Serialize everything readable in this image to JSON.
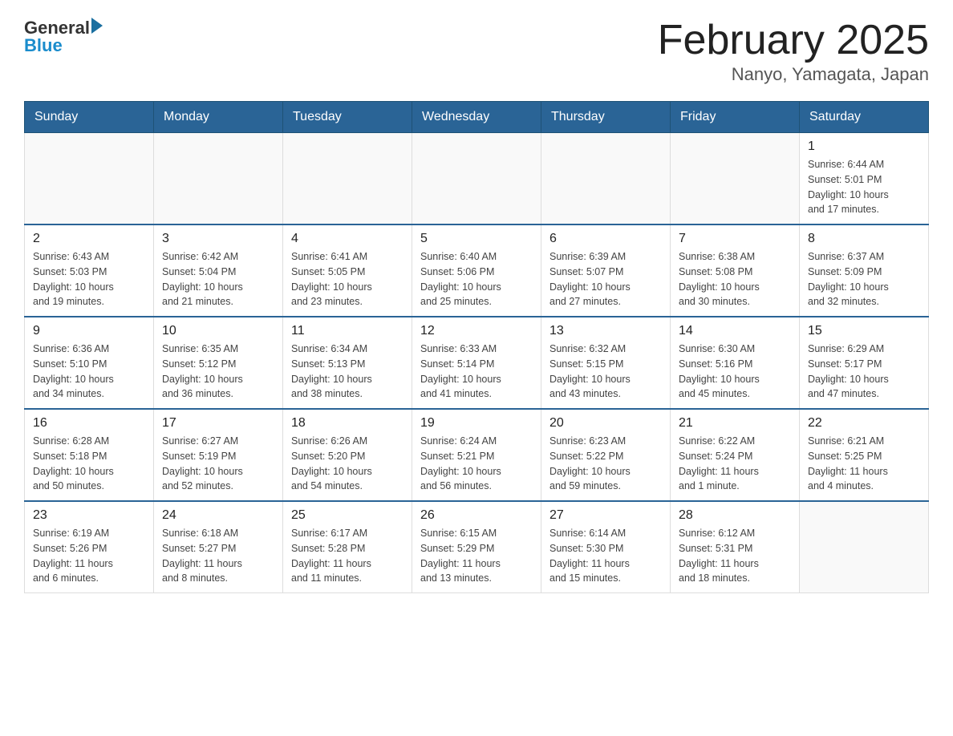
{
  "header": {
    "logo_general": "General",
    "logo_blue": "Blue",
    "title": "February 2025",
    "subtitle": "Nanyo, Yamagata, Japan"
  },
  "days_of_week": [
    "Sunday",
    "Monday",
    "Tuesday",
    "Wednesday",
    "Thursday",
    "Friday",
    "Saturday"
  ],
  "weeks": [
    {
      "days": [
        {
          "num": "",
          "info": ""
        },
        {
          "num": "",
          "info": ""
        },
        {
          "num": "",
          "info": ""
        },
        {
          "num": "",
          "info": ""
        },
        {
          "num": "",
          "info": ""
        },
        {
          "num": "",
          "info": ""
        },
        {
          "num": "1",
          "info": "Sunrise: 6:44 AM\nSunset: 5:01 PM\nDaylight: 10 hours\nand 17 minutes."
        }
      ]
    },
    {
      "days": [
        {
          "num": "2",
          "info": "Sunrise: 6:43 AM\nSunset: 5:03 PM\nDaylight: 10 hours\nand 19 minutes."
        },
        {
          "num": "3",
          "info": "Sunrise: 6:42 AM\nSunset: 5:04 PM\nDaylight: 10 hours\nand 21 minutes."
        },
        {
          "num": "4",
          "info": "Sunrise: 6:41 AM\nSunset: 5:05 PM\nDaylight: 10 hours\nand 23 minutes."
        },
        {
          "num": "5",
          "info": "Sunrise: 6:40 AM\nSunset: 5:06 PM\nDaylight: 10 hours\nand 25 minutes."
        },
        {
          "num": "6",
          "info": "Sunrise: 6:39 AM\nSunset: 5:07 PM\nDaylight: 10 hours\nand 27 minutes."
        },
        {
          "num": "7",
          "info": "Sunrise: 6:38 AM\nSunset: 5:08 PM\nDaylight: 10 hours\nand 30 minutes."
        },
        {
          "num": "8",
          "info": "Sunrise: 6:37 AM\nSunset: 5:09 PM\nDaylight: 10 hours\nand 32 minutes."
        }
      ]
    },
    {
      "days": [
        {
          "num": "9",
          "info": "Sunrise: 6:36 AM\nSunset: 5:10 PM\nDaylight: 10 hours\nand 34 minutes."
        },
        {
          "num": "10",
          "info": "Sunrise: 6:35 AM\nSunset: 5:12 PM\nDaylight: 10 hours\nand 36 minutes."
        },
        {
          "num": "11",
          "info": "Sunrise: 6:34 AM\nSunset: 5:13 PM\nDaylight: 10 hours\nand 38 minutes."
        },
        {
          "num": "12",
          "info": "Sunrise: 6:33 AM\nSunset: 5:14 PM\nDaylight: 10 hours\nand 41 minutes."
        },
        {
          "num": "13",
          "info": "Sunrise: 6:32 AM\nSunset: 5:15 PM\nDaylight: 10 hours\nand 43 minutes."
        },
        {
          "num": "14",
          "info": "Sunrise: 6:30 AM\nSunset: 5:16 PM\nDaylight: 10 hours\nand 45 minutes."
        },
        {
          "num": "15",
          "info": "Sunrise: 6:29 AM\nSunset: 5:17 PM\nDaylight: 10 hours\nand 47 minutes."
        }
      ]
    },
    {
      "days": [
        {
          "num": "16",
          "info": "Sunrise: 6:28 AM\nSunset: 5:18 PM\nDaylight: 10 hours\nand 50 minutes."
        },
        {
          "num": "17",
          "info": "Sunrise: 6:27 AM\nSunset: 5:19 PM\nDaylight: 10 hours\nand 52 minutes."
        },
        {
          "num": "18",
          "info": "Sunrise: 6:26 AM\nSunset: 5:20 PM\nDaylight: 10 hours\nand 54 minutes."
        },
        {
          "num": "19",
          "info": "Sunrise: 6:24 AM\nSunset: 5:21 PM\nDaylight: 10 hours\nand 56 minutes."
        },
        {
          "num": "20",
          "info": "Sunrise: 6:23 AM\nSunset: 5:22 PM\nDaylight: 10 hours\nand 59 minutes."
        },
        {
          "num": "21",
          "info": "Sunrise: 6:22 AM\nSunset: 5:24 PM\nDaylight: 11 hours\nand 1 minute."
        },
        {
          "num": "22",
          "info": "Sunrise: 6:21 AM\nSunset: 5:25 PM\nDaylight: 11 hours\nand 4 minutes."
        }
      ]
    },
    {
      "days": [
        {
          "num": "23",
          "info": "Sunrise: 6:19 AM\nSunset: 5:26 PM\nDaylight: 11 hours\nand 6 minutes."
        },
        {
          "num": "24",
          "info": "Sunrise: 6:18 AM\nSunset: 5:27 PM\nDaylight: 11 hours\nand 8 minutes."
        },
        {
          "num": "25",
          "info": "Sunrise: 6:17 AM\nSunset: 5:28 PM\nDaylight: 11 hours\nand 11 minutes."
        },
        {
          "num": "26",
          "info": "Sunrise: 6:15 AM\nSunset: 5:29 PM\nDaylight: 11 hours\nand 13 minutes."
        },
        {
          "num": "27",
          "info": "Sunrise: 6:14 AM\nSunset: 5:30 PM\nDaylight: 11 hours\nand 15 minutes."
        },
        {
          "num": "28",
          "info": "Sunrise: 6:12 AM\nSunset: 5:31 PM\nDaylight: 11 hours\nand 18 minutes."
        },
        {
          "num": "",
          "info": ""
        }
      ]
    }
  ]
}
